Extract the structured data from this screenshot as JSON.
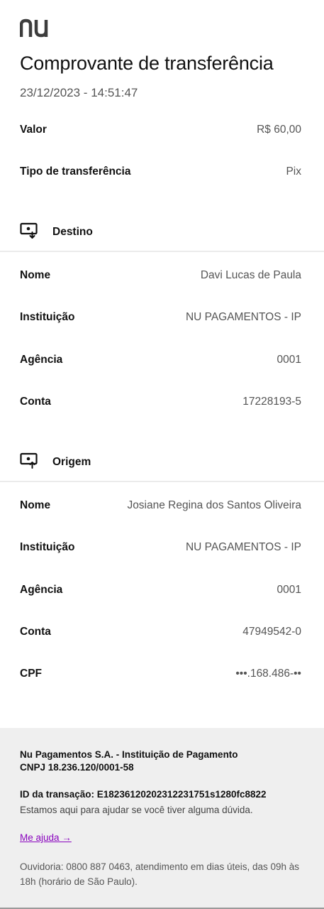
{
  "header": {
    "logo_text": "nu",
    "title": "Comprovante de transferência",
    "datetime": "23/12/2023 - 14:51:47"
  },
  "summary": {
    "valor_label": "Valor",
    "valor_value": "R$ 60,00",
    "tipo_label": "Tipo de transferência",
    "tipo_value": "Pix"
  },
  "destino": {
    "section_label": "Destino",
    "icon": "receive-screen-icon",
    "nome_label": "Nome",
    "nome_value": "Davi Lucas de Paula",
    "instituicao_label": "Instituição",
    "instituicao_value": "NU PAGAMENTOS - IP",
    "agencia_label": "Agência",
    "agencia_value": "0001",
    "conta_label": "Conta",
    "conta_value": "17228193-5"
  },
  "origem": {
    "section_label": "Origem",
    "icon": "send-screen-icon",
    "nome_label": "Nome",
    "nome_value": "Josiane Regina dos Santos Oliveira",
    "instituicao_label": "Instituição",
    "instituicao_value": "NU PAGAMENTOS - IP",
    "agencia_label": "Agência",
    "agencia_value": "0001",
    "conta_label": "Conta",
    "conta_value": "47949542-0",
    "cpf_label": "CPF",
    "cpf_value": "•••.168.486-••"
  },
  "footer": {
    "company_line1": "Nu Pagamentos S.A. - Instituição de Pagamento",
    "company_line2": "CNPJ 18.236.120/0001-58",
    "transaction_id": "ID da transação: E18236120202312231751s1280fc8822",
    "help_text": "Estamos aqui para ajudar se você tiver alguma dúvida.",
    "help_link": "Me ajuda →",
    "ouvidoria": "Ouvidoria: 0800 887 0463, atendimento em dias úteis, das 09h às 18h (horário de São Paulo)."
  },
  "colors": {
    "brand_purple": "#8a05be",
    "logo_gray": "#3c3c3c",
    "footer_bg": "#efefef"
  }
}
